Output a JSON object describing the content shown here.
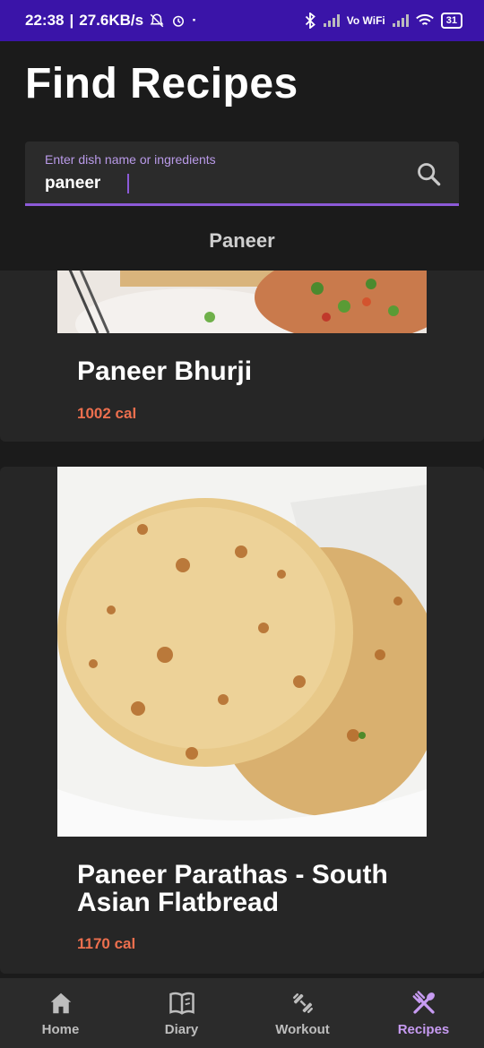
{
  "status_bar": {
    "time": "22:38",
    "speed": "27.6KB/s",
    "network_label": "Vo WiFi",
    "battery": "31"
  },
  "header": {
    "title": "Find Recipes"
  },
  "search": {
    "label": "Enter dish name or ingredients",
    "value": "paneer",
    "icon": "search-icon"
  },
  "section": {
    "title": "Paneer"
  },
  "recipes": [
    {
      "name": "Paneer Bhurji",
      "calories": "1002 cal"
    },
    {
      "name": "Paneer Parathas - South Asian Flatbread",
      "calories": "1170 cal"
    }
  ],
  "nav": {
    "items": [
      {
        "label": "Home",
        "icon": "home-icon"
      },
      {
        "label": "Diary",
        "icon": "book-icon"
      },
      {
        "label": "Workout",
        "icon": "dumbbell-icon"
      },
      {
        "label": "Recipes",
        "icon": "utensils-icon"
      }
    ],
    "active": "Recipes"
  },
  "colors": {
    "status_bar": "#3a14a8",
    "accent": "#8c5ad8",
    "calories": "#ec6f4e",
    "background": "#1b1b1b",
    "card": "#262626"
  }
}
